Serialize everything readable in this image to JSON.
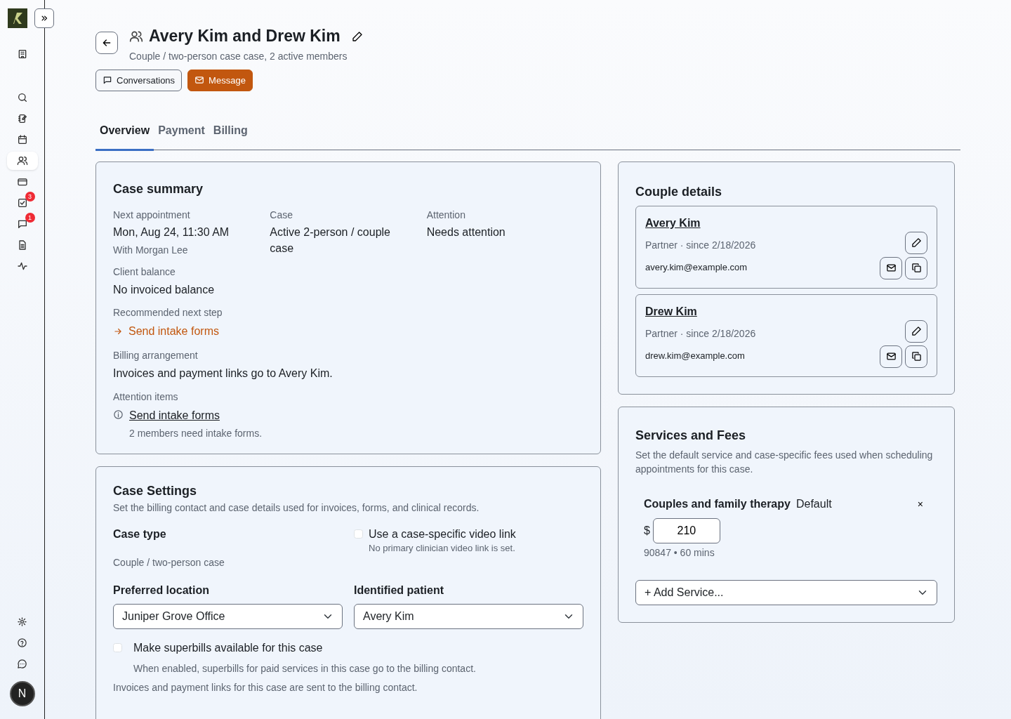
{
  "sidebar": {
    "top_items": [
      {
        "selected": false
      },
      {
        "selected": false
      },
      {
        "selected": false
      },
      {
        "selected": false
      },
      {
        "selected": true
      },
      {
        "selected": false
      },
      {
        "selected": false,
        "badge": "3"
      },
      {
        "selected": false,
        "badge": "1"
      },
      {
        "selected": false
      },
      {
        "selected": false
      }
    ],
    "bottom_items": [
      {
        "selected": false
      },
      {
        "selected": false
      },
      {
        "selected": false
      }
    ],
    "avatar": {
      "initial": "N"
    }
  },
  "header": {
    "title": "Avery Kim and Drew Kim",
    "subtitle": "Couple / two-person case case, 2 active members",
    "buttons": [
      {
        "label": "Conversations",
        "kind": "outline"
      },
      {
        "label": "Message",
        "kind": "primary"
      }
    ]
  },
  "tabs": [
    {
      "label": "Overview",
      "selected": true
    },
    {
      "label": "Payment",
      "selected": false
    },
    {
      "label": "Billing",
      "selected": false
    }
  ],
  "case_summary": {
    "title": "Case summary",
    "fields": [
      {
        "label": "Next appointment",
        "value": "Mon, Aug 24, 11:30 AM",
        "note": "With Morgan Lee"
      },
      {
        "label": "Case",
        "value": "Active 2-person / couple case"
      },
      {
        "label": "Attention",
        "value": "Needs attention"
      }
    ],
    "balance": {
      "label": "Client balance",
      "value": "No invoiced balance"
    },
    "next_step": {
      "label": "Recommended next step",
      "link": "Send intake forms"
    },
    "billing": {
      "label": "Billing arrangement",
      "value": "Invoices and payment links go to Avery Kim."
    },
    "attention": {
      "label": "Attention items",
      "items": [
        {
          "link": "Send intake forms",
          "note": "2 members need intake forms."
        }
      ]
    }
  },
  "case_settings": {
    "title": "Case Settings",
    "description": "Set the billing contact and case details used for invoices, forms, and clinical records.",
    "case_type": {
      "label": "Case type",
      "value": "Couple / two-person case"
    },
    "video_link": {
      "label": "Use a case-specific video link",
      "checked": false,
      "note": "No primary clinician video link is set."
    },
    "location": {
      "label": "Preferred location",
      "value": "Juniper Grove Office"
    },
    "patient": {
      "label": "Identified patient",
      "value": "Avery Kim"
    },
    "superbills": {
      "label": "Make superbills available for this case",
      "checked": false,
      "note": "When enabled, superbills for paid services in this case go to the billing contact."
    },
    "footer_note": "Invoices and payment links for this case are sent to the billing contact."
  },
  "couple_details": {
    "title": "Couple details",
    "members": [
      {
        "name": "Avery Kim",
        "role": "Partner · since 2/18/2026",
        "email": "avery.kim@example.com"
      },
      {
        "name": "Drew Kim",
        "role": "Partner · since 2/18/2026",
        "email": "drew.kim@example.com"
      }
    ]
  },
  "services": {
    "title": "Services and Fees",
    "description": "Set the default service and case-specific fees used when scheduling appointments for this case.",
    "items": [
      {
        "name": "Couples and family therapy",
        "tag": "Default",
        "remove": "×",
        "currency": "$",
        "fee": "210",
        "meta": "90847 • 60 mins"
      }
    ],
    "add_select": "+ Add Service..."
  }
}
